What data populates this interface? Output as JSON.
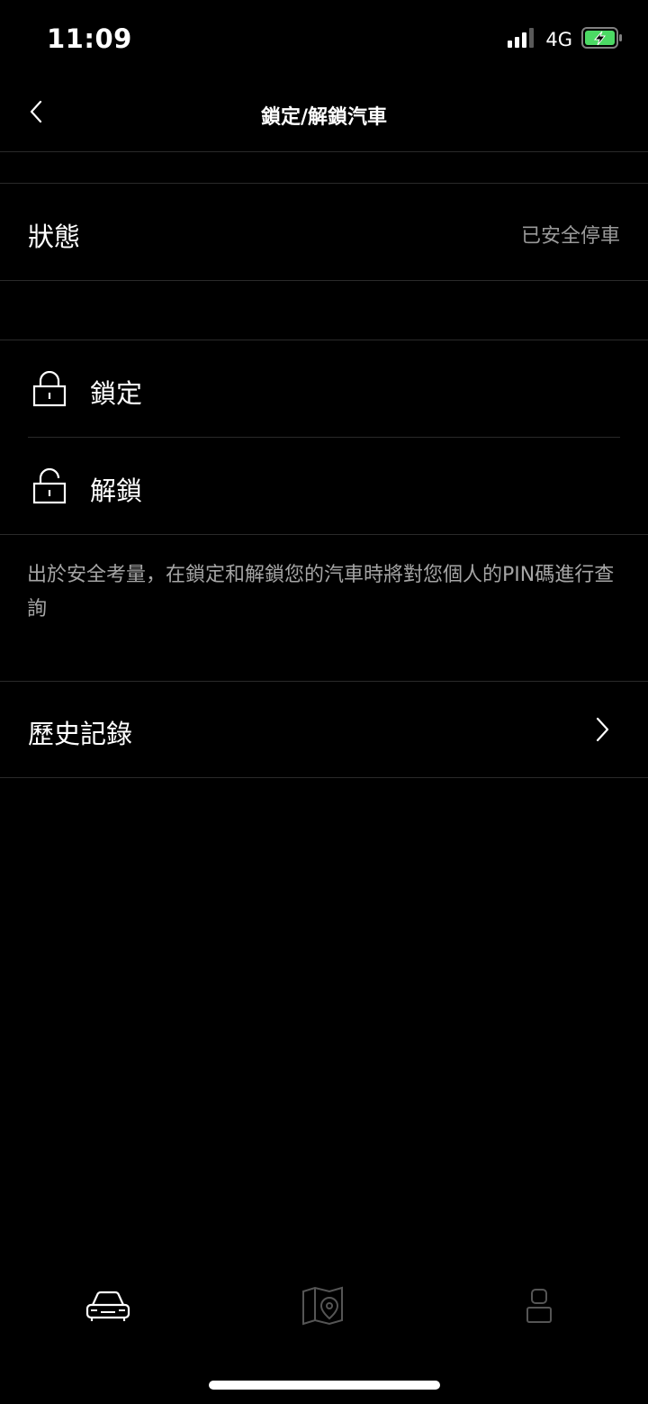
{
  "status_bar": {
    "time": "11:09",
    "network": "4G",
    "icons": [
      "signal-icon",
      "battery-charging-icon"
    ]
  },
  "nav": {
    "title": "鎖定/解鎖汽車",
    "back_icon": "chevron-left-icon"
  },
  "vehicle_status": {
    "label": "狀態",
    "value": "已安全停車"
  },
  "actions": [
    {
      "label": "鎖定",
      "icon": "lock-closed-icon"
    },
    {
      "label": "解鎖",
      "icon": "lock-open-icon"
    }
  ],
  "info": {
    "text": "出於安全考量，在鎖定和解鎖您的汽車時將對您個人的PIN碼進行查詢"
  },
  "history": {
    "label": "歷史記錄",
    "icon": "chevron-right-icon"
  },
  "tab_bar": {
    "tabs": [
      {
        "name": "car",
        "icon": "car-icon",
        "active": true
      },
      {
        "name": "map",
        "icon": "map-pin-icon",
        "active": false
      },
      {
        "name": "profile",
        "icon": "person-icon",
        "active": false
      }
    ]
  },
  "colors": {
    "background": "#000000",
    "text": "#ffffff",
    "secondary_text": "#9a9a9a",
    "divider": "#2a2a2a",
    "battery_green": "#4cd964",
    "inactive_tab": "#555555"
  }
}
